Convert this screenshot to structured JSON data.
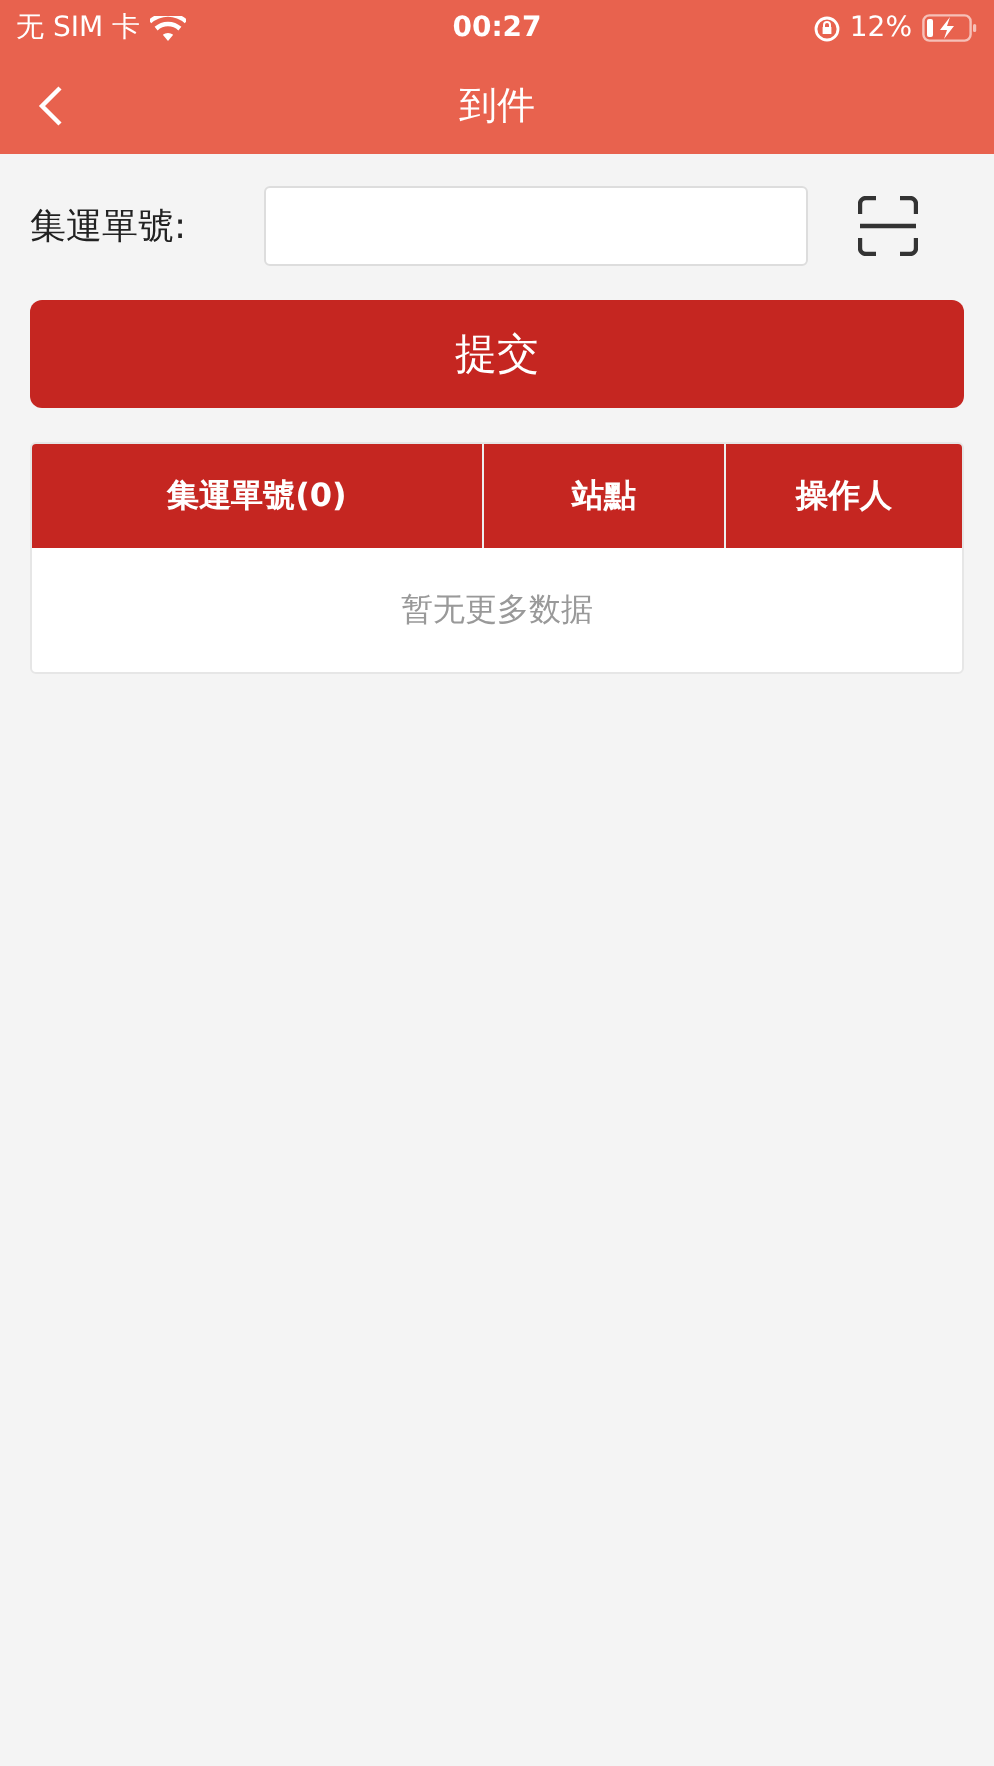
{
  "status_bar": {
    "carrier": "无 SIM 卡",
    "time": "00:27",
    "battery": "12%"
  },
  "nav": {
    "title": "到件"
  },
  "form": {
    "label": "集運單號:",
    "button": "提交"
  },
  "table": {
    "columns": [
      "集運單號(0)",
      "站點",
      "操作人"
    ],
    "empty": "暂无更多数据"
  }
}
